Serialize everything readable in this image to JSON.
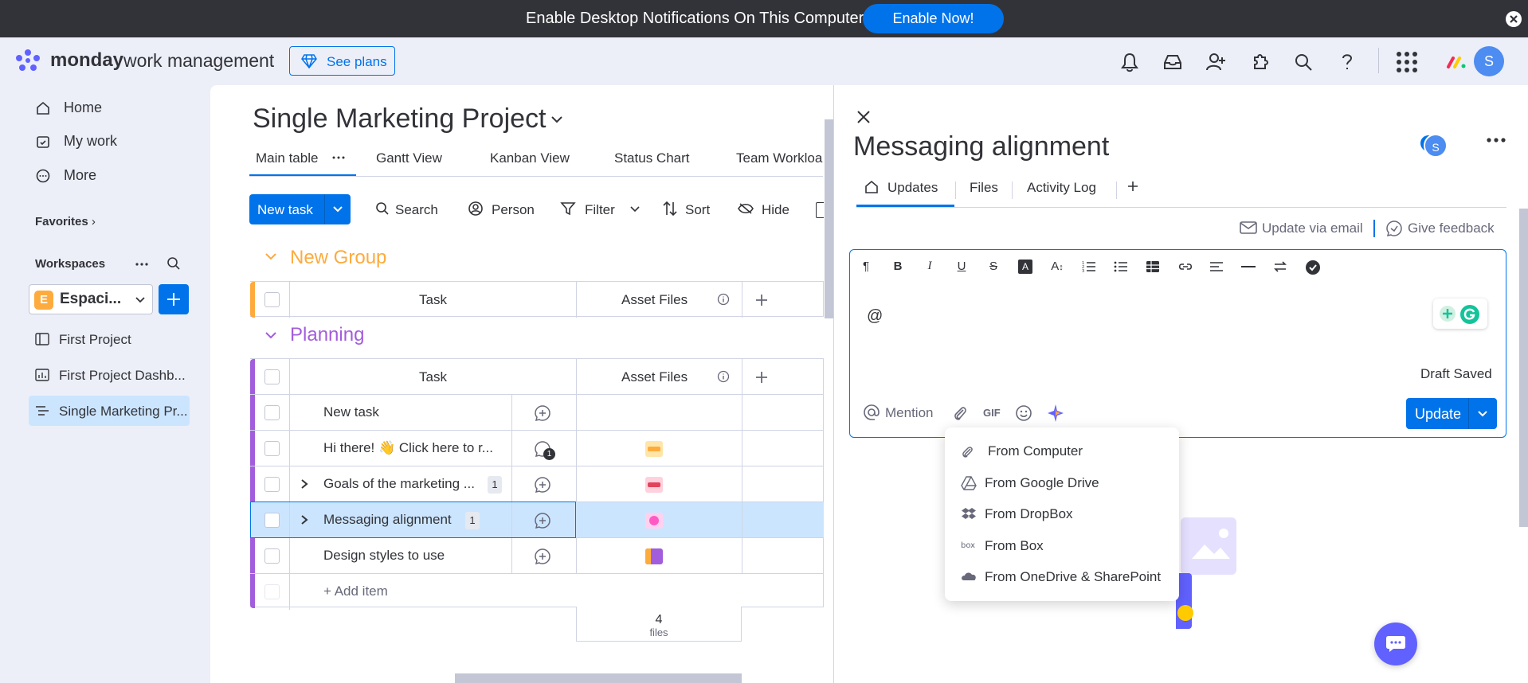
{
  "notification": {
    "text": "Enable Desktop Notifications On This Computer",
    "button": "Enable Now!"
  },
  "topbar": {
    "brand_bold": "monday",
    "brand_rest": "work management",
    "see_plans": "See plans",
    "avatar_initial": "S"
  },
  "sidebar": {
    "nav": [
      {
        "label": "Home",
        "icon": "home-icon"
      },
      {
        "label": "My work",
        "icon": "checkbox-calendar-icon"
      },
      {
        "label": "More",
        "icon": "more-circle-icon"
      }
    ],
    "favorites_label": "Favorites",
    "workspaces_label": "Workspaces",
    "workspace_badge": "E",
    "workspace_name": "Espaci...",
    "boards": [
      {
        "label": "First Project",
        "icon": "board-icon"
      },
      {
        "label": "First Project Dashb...",
        "icon": "dashboard-icon"
      },
      {
        "label": "Single Marketing Pr...",
        "icon": "board-lines-icon",
        "active": true
      }
    ]
  },
  "board": {
    "title": "Single Marketing Project",
    "tabs": [
      "Main table",
      "Gantt View",
      "Kanban View",
      "Status Chart",
      "Team Workloa"
    ],
    "toolbar": {
      "new_task": "New task",
      "search": "Search",
      "person": "Person",
      "filter": "Filter",
      "sort": "Sort",
      "hide": "Hide"
    },
    "groups": [
      {
        "name": "New Group",
        "color": "#fdab3d",
        "columns": [
          "Task",
          "Asset Files"
        ],
        "rows": []
      },
      {
        "name": "Planning",
        "color": "#a25ddc",
        "columns": [
          "Task",
          "Asset Files"
        ],
        "rows": [
          {
            "task": "New task",
            "subitems": "",
            "file_color": ""
          },
          {
            "task": "Hi there! 👋 Click here to r...",
            "subitems": "",
            "file_color": "#fdab3d",
            "update_count": "1"
          },
          {
            "task": "Goals of the marketing ...",
            "subitems": "1",
            "file_color": "#e2445c"
          },
          {
            "task": "Messaging alignment",
            "subitems": "1",
            "file_color": "#ff5ac4",
            "selected": true
          },
          {
            "task": "Design styles to use",
            "subitems": "",
            "file_color": "#a25ddc"
          }
        ],
        "add_item": "+ Add item",
        "summary_count": "4",
        "summary_unit": "files"
      }
    ]
  },
  "panel": {
    "title": "Messaging alignment",
    "avatar_initial": "S",
    "tabs": [
      "Updates",
      "Files",
      "Activity Log"
    ],
    "update_via_email": "Update via email",
    "give_feedback": "Give feedback",
    "editor_text": "@",
    "draft_status": "Draft Saved",
    "mention": "Mention",
    "gif": "GIF",
    "update_button": "Update",
    "attach_menu": [
      "From Computer",
      "From Google Drive",
      "From DropBox",
      "From Box",
      "From OneDrive & SharePoint"
    ]
  }
}
